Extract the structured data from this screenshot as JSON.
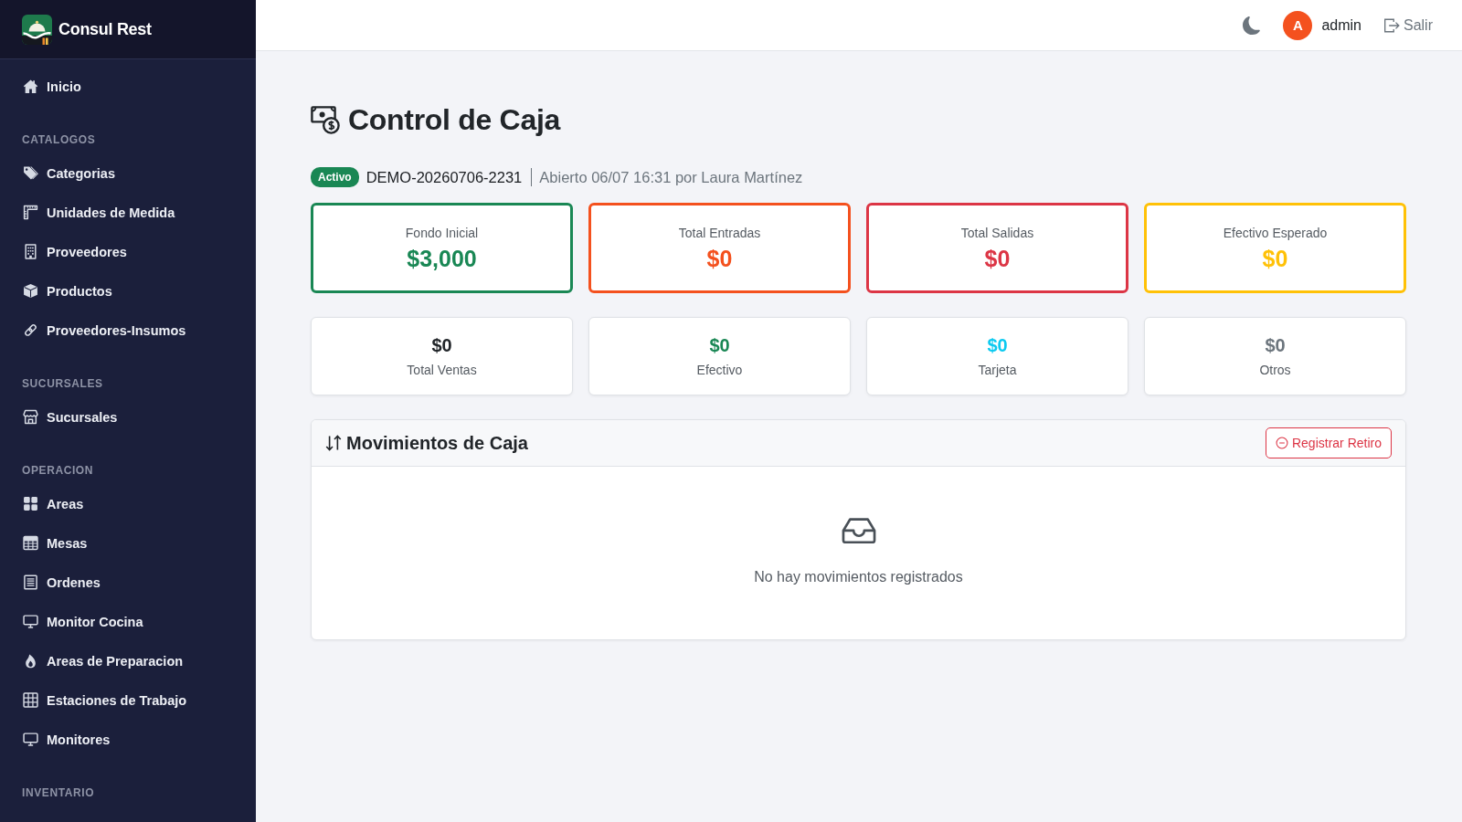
{
  "sidebar": {
    "brand": "Consul Rest",
    "sections": [
      {
        "items": [
          {
            "label": "Inicio",
            "selected": false
          }
        ]
      },
      {
        "title": "CATALOGOS",
        "items": [
          {
            "label": "Categorias",
            "selected": false
          },
          {
            "label": "Unidades de Medida",
            "selected": false
          },
          {
            "label": "Proveedores",
            "selected": false
          },
          {
            "label": "Productos",
            "selected": false
          },
          {
            "label": "Proveedores-Insumos",
            "selected": false
          }
        ]
      },
      {
        "title": "SUCURSALES",
        "items": [
          {
            "label": "Sucursales",
            "selected": false
          }
        ]
      },
      {
        "title": "OPERACION",
        "items": [
          {
            "label": "Areas",
            "selected": false
          },
          {
            "label": "Mesas",
            "selected": false
          },
          {
            "label": "Ordenes",
            "selected": false
          },
          {
            "label": "Monitor Cocina",
            "selected": false
          },
          {
            "label": "Areas de Preparacion",
            "selected": false
          },
          {
            "label": "Estaciones de Trabajo",
            "selected": false
          },
          {
            "label": "Monitores",
            "selected": false
          }
        ]
      },
      {
        "title": "INVENTARIO"
      }
    ]
  },
  "header": {
    "user": {
      "initial": "A",
      "name": "admin"
    },
    "logout": "Salir"
  },
  "page_title": "Control de Caja",
  "session": {
    "status": "Activo",
    "code": "DEMO-20260706-2231",
    "opened": "Abierto 06/07 16:31 por Laura Martínez"
  },
  "summary_cards": [
    {
      "label": "Fondo Inicial",
      "value": "$3,000",
      "color": "#198754"
    },
    {
      "label": "Total Entradas",
      "value": "$0",
      "color": "#f4511e"
    },
    {
      "label": "Total Salidas",
      "value": "$0",
      "color": "#dc3545"
    },
    {
      "label": "Efectivo Esperado",
      "value": "$0",
      "color": "#ffc107"
    }
  ],
  "payment_cards": [
    {
      "label": "Total Ventas",
      "value": "$0",
      "color": "#212529"
    },
    {
      "label": "Efectivo",
      "value": "$0",
      "color": "#198754"
    },
    {
      "label": "Tarjeta",
      "value": "$0",
      "color": "#0dcaf0"
    },
    {
      "label": "Otros",
      "value": "$0",
      "color": "#6c757d"
    }
  ],
  "movements": {
    "title": "Movimientos de Caja",
    "action": "Registrar Retiro",
    "empty_message": "No hay movimientos registrados"
  }
}
